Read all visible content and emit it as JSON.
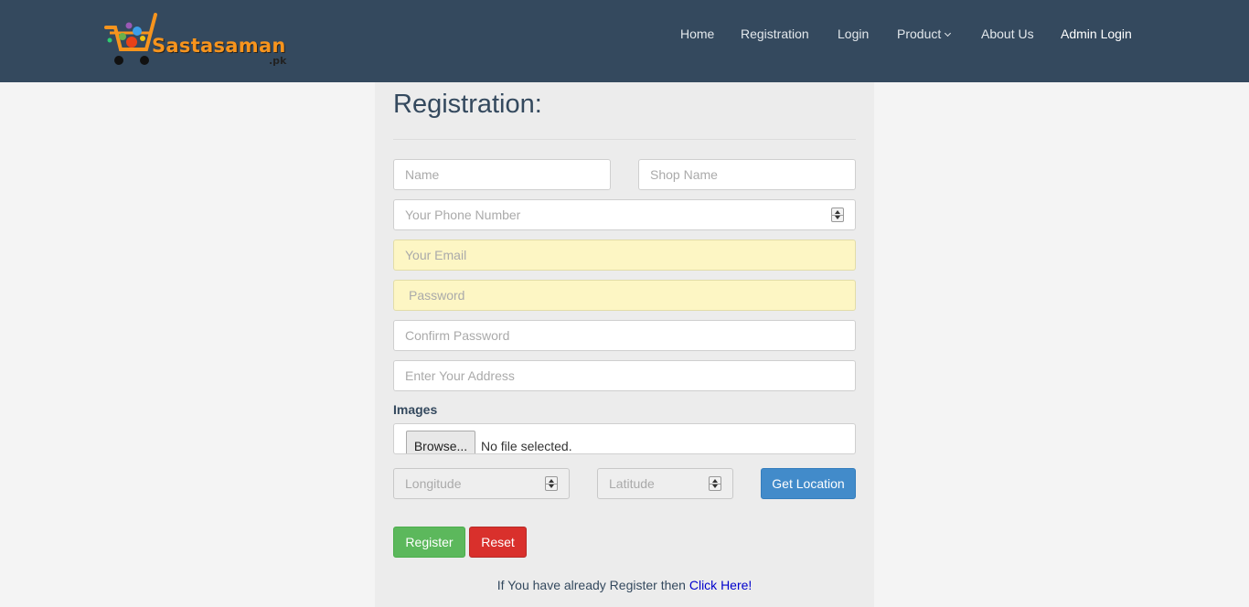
{
  "brand": {
    "name": "Sastasaman",
    "suffix": ".pk"
  },
  "nav": {
    "home": "Home",
    "registration": "Registration",
    "login": "Login",
    "product": "Product",
    "about": "About Us",
    "admin": "Admin Login"
  },
  "form": {
    "title": "Registration:",
    "name_placeholder": "Name",
    "shop_placeholder": "Shop Name",
    "phone_placeholder": "Your Phone Number",
    "email_placeholder": "Your Email",
    "password_placeholder": "Password",
    "confirm_placeholder": "Confirm Password",
    "address_placeholder": "Enter Your Address",
    "images_label": "Images",
    "browse_label": "Browse...",
    "file_status": "No file selected.",
    "longitude_placeholder": "Longitude",
    "latitude_placeholder": "Latitude",
    "get_location_label": "Get Location",
    "register_label": "Register",
    "reset_label": "Reset"
  },
  "footer": {
    "prefix": "If You have already Register then ",
    "link": "Click Here!"
  },
  "colors": {
    "navbar": "#34495e",
    "accent_orange": "#f7941d",
    "primary": "#428bca",
    "success": "#5cb85c",
    "danger": "#d9302c"
  }
}
